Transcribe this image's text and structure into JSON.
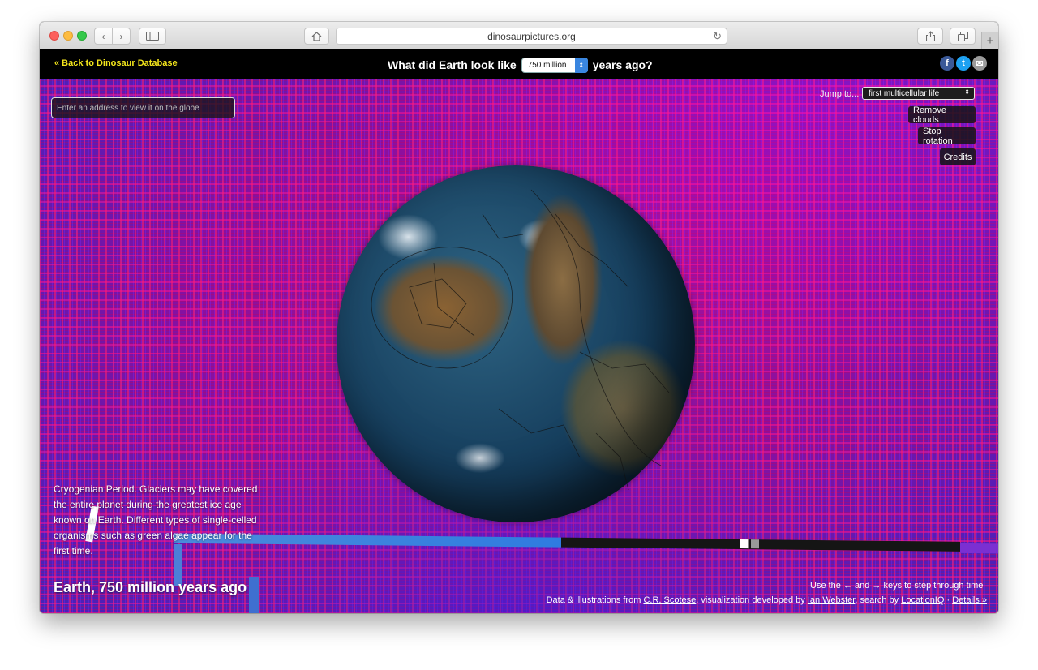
{
  "browser": {
    "url": "dinosaurpictures.org"
  },
  "site": {
    "back_link": "« Back to Dinosaur Database",
    "headline_prefix": "What did Earth look like",
    "year_value": "750 million",
    "headline_suffix": "years ago?"
  },
  "search": {
    "placeholder": "Enter an address to view it on the globe"
  },
  "controls": {
    "jump_label": "Jump to...",
    "jump_value": "first multicellular life",
    "remove_clouds": "Remove clouds",
    "stop_rotation": "Stop rotation",
    "credits": "Credits"
  },
  "description": "Cryogenian Period. Glaciers may have covered the entire planet during the greatest ice age known on Earth. Different types of single-celled organisms such as green algae appear for the first time.",
  "bottom_title": "Earth, 750 million years ago",
  "footer": {
    "hint": "Use the ← and → keys to step through time",
    "data_prefix": "Data & illustrations from",
    "data_author": "C.R. Scotese",
    "viz_prefix": ", visualization developed by",
    "viz_author": "Ian Webster",
    "search_prefix": ", search by",
    "search_provider": "LocationIQ",
    "separator": " · ",
    "details": "Details »"
  },
  "icons": {
    "facebook": "f",
    "twitter": "t",
    "mail": "✉"
  },
  "colors": {
    "link_yellow": "#f3e51b",
    "facebook": "#3b5998",
    "twitter": "#1da1f2"
  }
}
